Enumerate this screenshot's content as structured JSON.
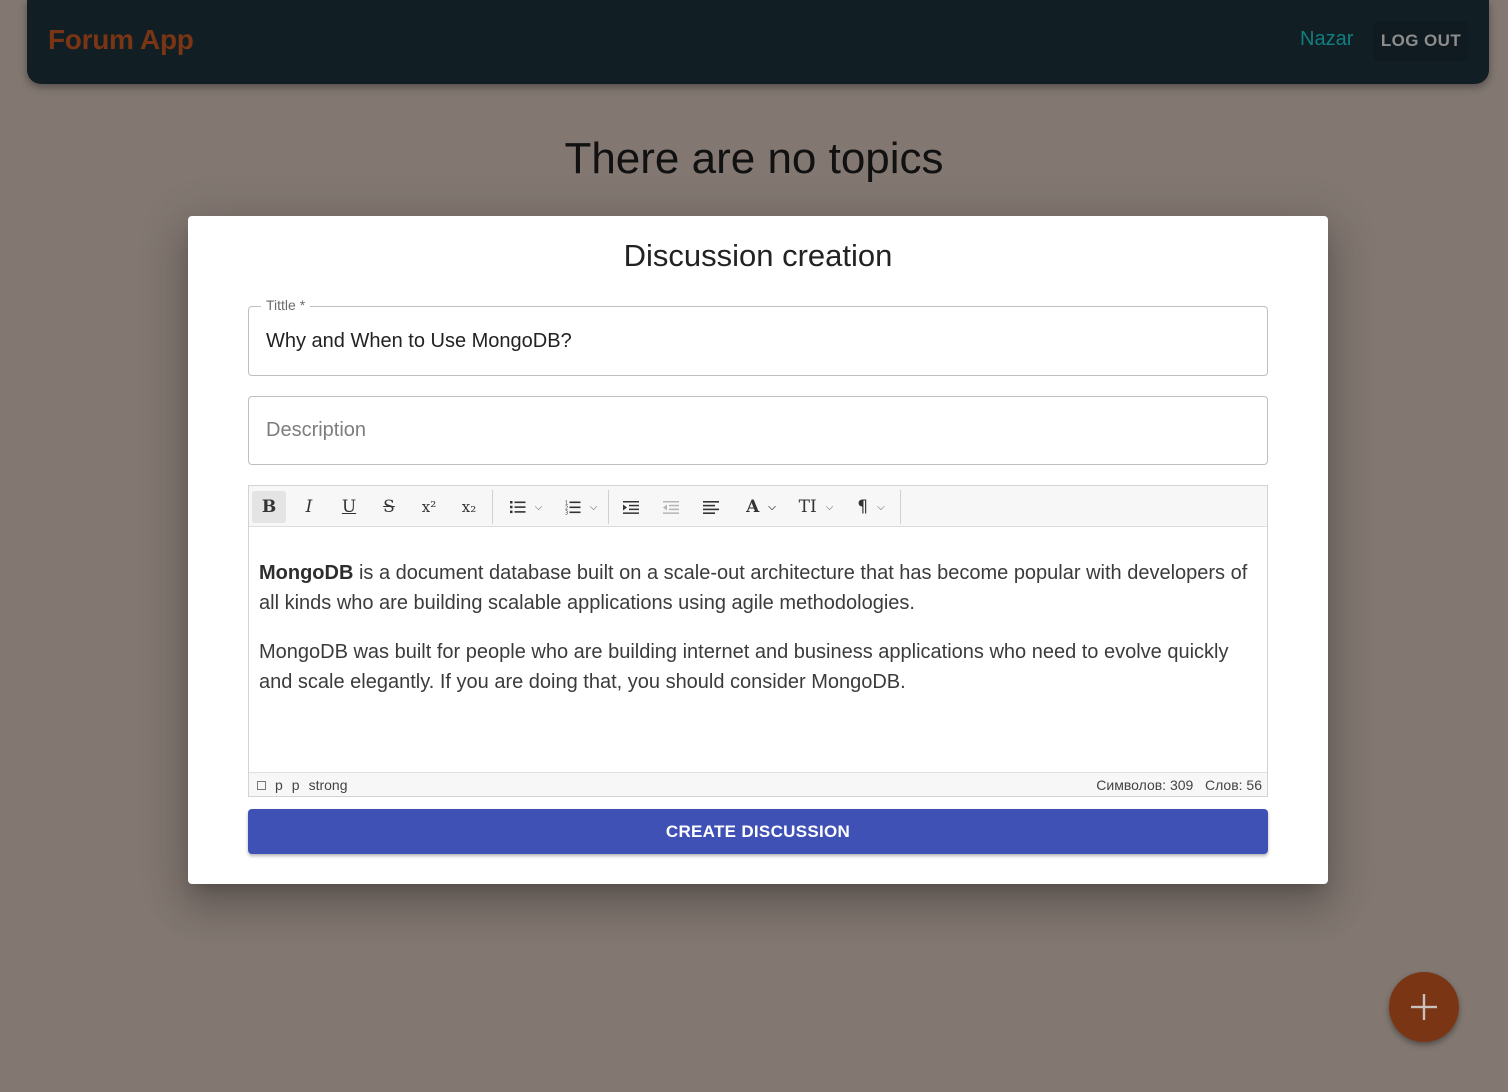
{
  "appbar": {
    "brand": "Forum App",
    "user_name": "Nazar",
    "logout_label": "LOG OUT"
  },
  "page": {
    "heading": "There are no topics"
  },
  "dialog": {
    "title": "Discussion creation",
    "title_field": {
      "label": "Tittle *",
      "value": "Why and When to Use MongoDB?"
    },
    "description_field": {
      "placeholder": "Description"
    },
    "editor": {
      "toolbar": [
        {
          "name": "bold",
          "glyph": "B"
        },
        {
          "name": "italic",
          "glyph": "I"
        },
        {
          "name": "underline",
          "glyph": "U"
        },
        {
          "name": "strikethrough",
          "glyph": "S"
        },
        {
          "name": "superscript",
          "glyph": "x²"
        },
        {
          "name": "subscript",
          "glyph": "x₂"
        },
        {
          "name": "bullet-list",
          "glyph": "list-ul"
        },
        {
          "name": "numbered-list",
          "glyph": "list-ol"
        },
        {
          "name": "indent",
          "glyph": "indent"
        },
        {
          "name": "outdent",
          "glyph": "outdent"
        },
        {
          "name": "align",
          "glyph": "align-left"
        },
        {
          "name": "font",
          "glyph": "A"
        },
        {
          "name": "font-size",
          "glyph": "TI"
        },
        {
          "name": "paragraph",
          "glyph": "¶"
        }
      ],
      "paragraphs": [
        {
          "bold": "MongoDB",
          "text": " is a document database built on a scale-out architecture that has become popular with developers of all kinds who are building scalable applications using agile methodologies."
        },
        {
          "text": "MongoDB was built for people who are building internet and business applications who need to evolve quickly and scale elegantly. If you are doing that, you should consider MongoDB."
        }
      ],
      "status": {
        "path": [
          "p",
          "p",
          "strong"
        ],
        "chars": "Символов: 309",
        "words": "Слов: 56"
      }
    },
    "submit_label": "CREATE DISCUSSION"
  },
  "fab": {
    "icon": "plus-icon"
  },
  "colors": {
    "background": "#827771",
    "appbar": "#111e24",
    "brand": "#7a3514",
    "user_name": "#127e80",
    "primary": "#3f51b5",
    "fab": "#7a3514"
  }
}
